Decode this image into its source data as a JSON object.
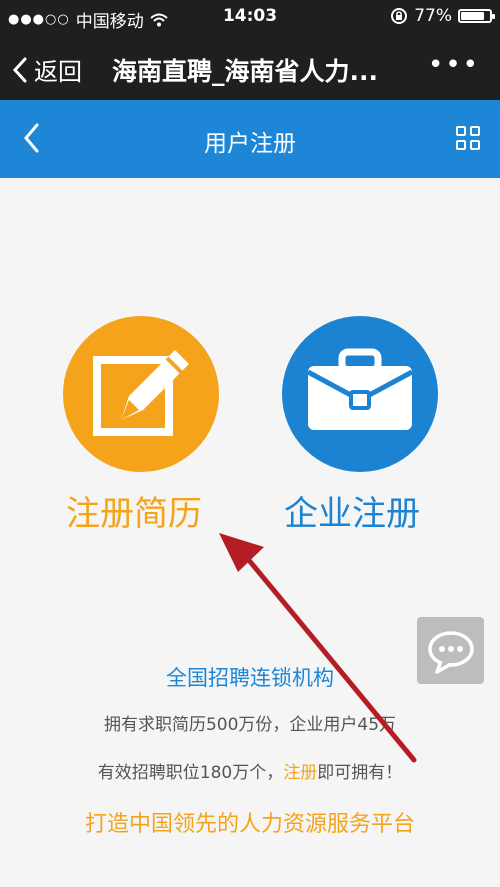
{
  "status_bar": {
    "carrier": "中国移动",
    "time": "14:03",
    "battery": "77%"
  },
  "wechat_bar": {
    "back_label": "返回",
    "title": "海南直聘_海南省人力..."
  },
  "app_bar": {
    "title": "用户注册"
  },
  "options": [
    {
      "label": "注册简历",
      "icon": "edit-icon",
      "color": "#f5a31a"
    },
    {
      "label": "企业注册",
      "icon": "briefcase-icon",
      "color": "#1c83d2"
    }
  ],
  "promo": {
    "headline": "全国招聘连锁机构",
    "line1": "拥有求职简历500万份，企业用户45万",
    "line2_pre": "有效招聘职位180万个，",
    "line2_link": "注册",
    "line2_post": "即可拥有！",
    "slogan": "打造中国领先的人力资源服务平台"
  },
  "colors": {
    "status_bg": "#1f1f1f",
    "app_bar_bg": "#1d86d6",
    "orange": "#f5a31a",
    "blue": "#1c83d2",
    "arrow": "#b51d24"
  }
}
